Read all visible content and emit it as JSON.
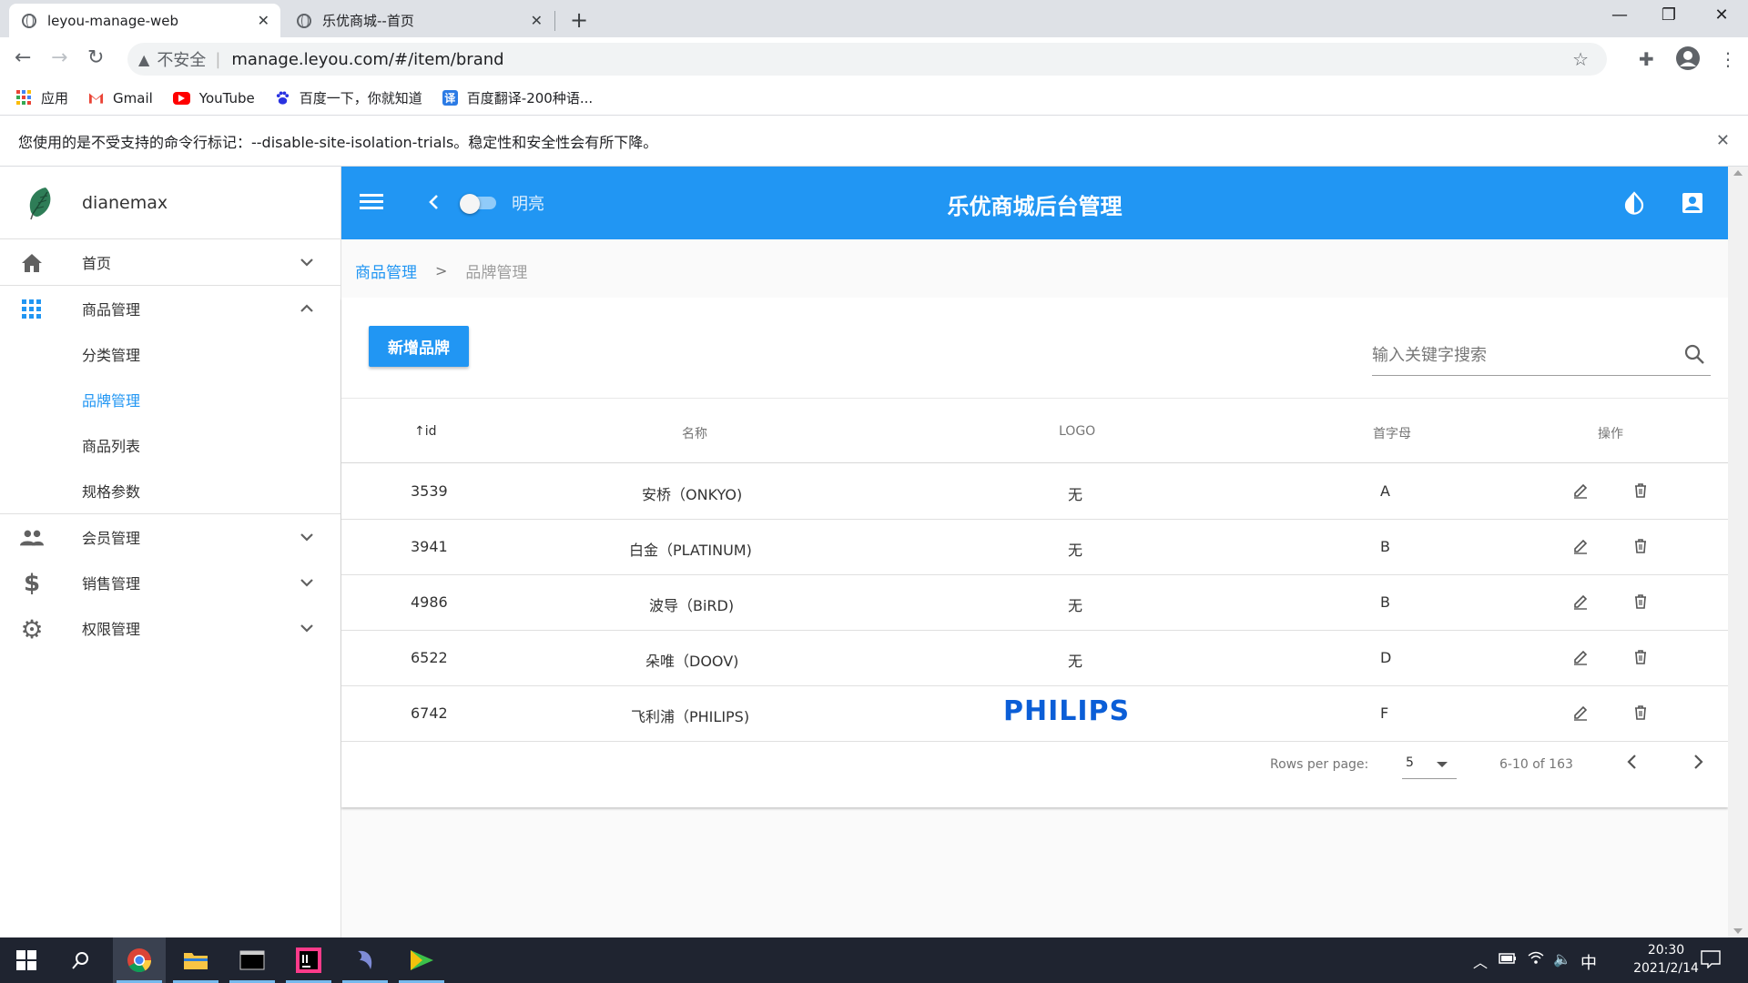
{
  "browser": {
    "tabs": [
      {
        "title": "leyou-manage-web",
        "close": "✕"
      },
      {
        "title": "乐优商城--首页",
        "close": "✕"
      }
    ],
    "new_tab": "+",
    "window_controls": {
      "minimize": "—",
      "maximize": "❐",
      "close": "✕"
    },
    "address": {
      "insecure_label": "不安全",
      "separator": "|",
      "url": "manage.leyou.com/#/item/brand"
    },
    "bookmarks": [
      {
        "label": "应用",
        "icon": "apps-grid-icon"
      },
      {
        "label": "Gmail",
        "icon": "gmail-icon"
      },
      {
        "label": "YouTube",
        "icon": "youtube-icon"
      },
      {
        "label": "百度一下，你就知道",
        "icon": "baidu-paw-icon"
      },
      {
        "label": "百度翻译-200种语...",
        "icon": "translate-icon"
      }
    ],
    "infobar": "您使用的是不受支持的命令行标记：--disable-site-isolation-trials。稳定性和安全性会有所下降。"
  },
  "sidebar": {
    "user_name": "dianemax",
    "items": [
      {
        "label": "首页",
        "icon": "home-icon",
        "expanded": false
      },
      {
        "label": "商品管理",
        "icon": "apps-icon",
        "expanded": true,
        "children": [
          {
            "label": "分类管理",
            "active": false
          },
          {
            "label": "品牌管理",
            "active": true
          },
          {
            "label": "商品列表",
            "active": false
          },
          {
            "label": "规格参数",
            "active": false
          }
        ]
      },
      {
        "label": "会员管理",
        "icon": "people-icon",
        "expanded": false
      },
      {
        "label": "销售管理",
        "icon": "dollar-icon",
        "expanded": false
      },
      {
        "label": "权限管理",
        "icon": "gear-icon",
        "expanded": false
      }
    ]
  },
  "appbar": {
    "title": "乐优商城后台管理",
    "switch_label": "明亮",
    "switch_on": false,
    "accent": "#2196f3"
  },
  "breadcrumb": {
    "parent": "商品管理",
    "separator": ">",
    "current": "品牌管理"
  },
  "toolbar": {
    "add_button": "新增品牌",
    "search_placeholder": "输入关键字搜索"
  },
  "table": {
    "headers": {
      "id": "id",
      "sort_arrow": "↑",
      "name": "名称",
      "logo": "LOGO",
      "letter": "首字母",
      "actions": "操作"
    },
    "rows": [
      {
        "id": "3539",
        "name": "安桥（ONKYO)",
        "logo": "无",
        "letter": "A"
      },
      {
        "id": "3941",
        "name": "白金（PLATINUM)",
        "logo": "无",
        "letter": "B"
      },
      {
        "id": "4986",
        "name": "波导（BiRD)",
        "logo": "无",
        "letter": "B"
      },
      {
        "id": "6522",
        "name": "朵唯（DOOV)",
        "logo": "无",
        "letter": "D"
      },
      {
        "id": "6742",
        "name": "飞利浦（PHILIPS)",
        "logo_image": "PHILIPS",
        "letter": "F"
      }
    ]
  },
  "pagination": {
    "rows_per_page_label": "Rows per page:",
    "rows_per_page": "5",
    "range": "6-10 of 163"
  },
  "taskbar": {
    "ime": "中",
    "time": "20:30",
    "date": "2021/2/14"
  }
}
